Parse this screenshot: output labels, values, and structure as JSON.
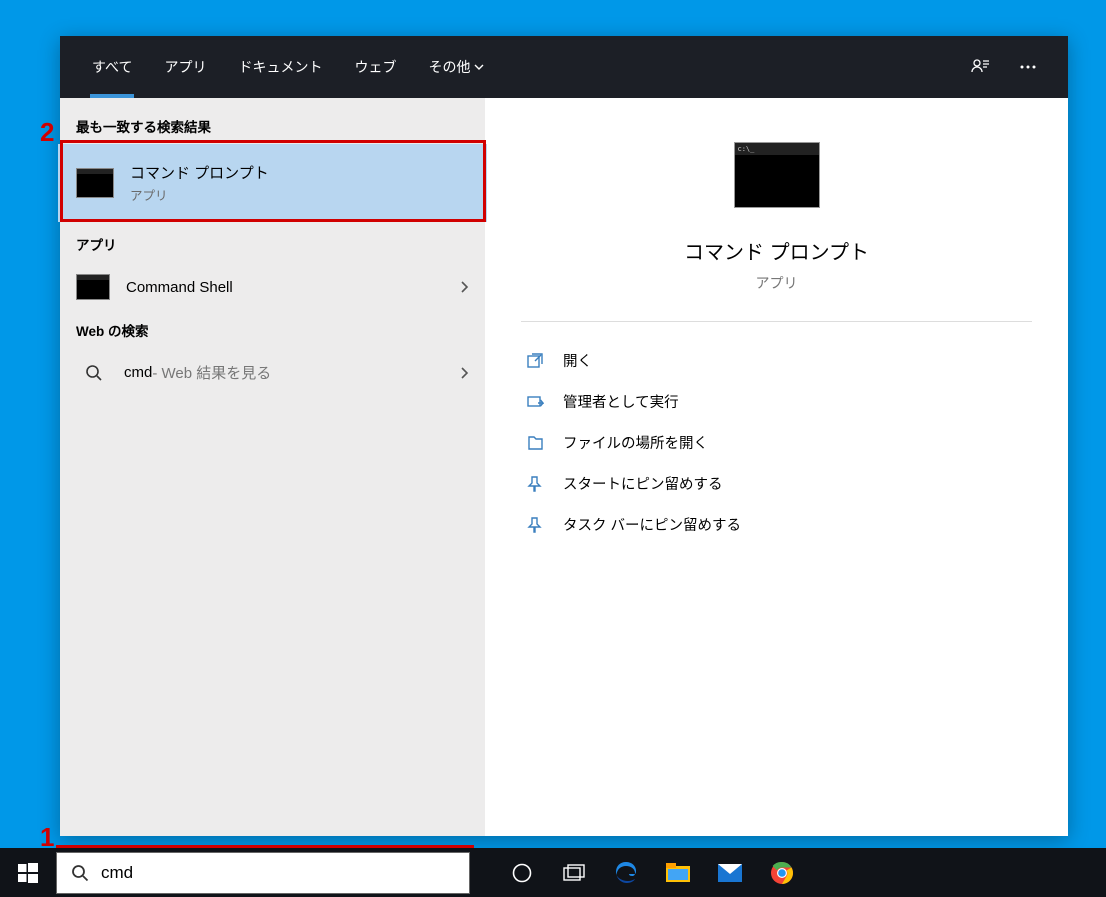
{
  "tabs": {
    "all": "すべて",
    "apps": "アプリ",
    "documents": "ドキュメント",
    "web": "ウェブ",
    "more": "その他"
  },
  "sections": {
    "best_match": "最も一致する検索結果",
    "apps": "アプリ",
    "web_search": "Web の検索"
  },
  "best_match": {
    "title": "コマンド プロンプト",
    "subtitle": "アプリ"
  },
  "app_results": [
    {
      "title": "Command Shell"
    }
  ],
  "web_results": {
    "query": "cmd",
    "hint": " - Web 結果を見る"
  },
  "preview": {
    "title": "コマンド プロンプト",
    "subtitle": "アプリ",
    "actions": [
      "開く",
      "管理者として実行",
      "ファイルの場所を開く",
      "スタートにピン留めする",
      "タスク バーにピン留めする"
    ]
  },
  "search_input": {
    "value": "cmd"
  },
  "annotations": {
    "one": "1",
    "two": "2"
  }
}
